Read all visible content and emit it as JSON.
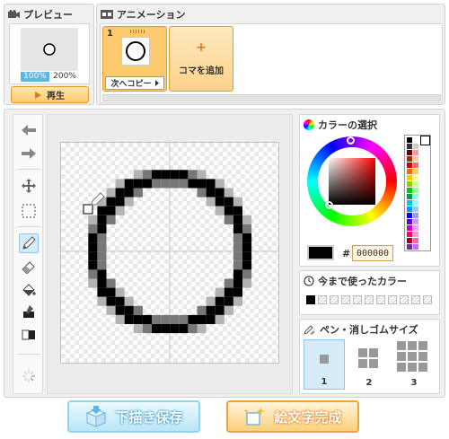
{
  "preview": {
    "title": "プレビュー",
    "zoom_100": "100%",
    "zoom_200": "200%",
    "play_label": "再生"
  },
  "animation": {
    "title": "アニメーション",
    "frame_number": "1",
    "next_copy_label": "次へコピー",
    "add_frame_label": "コマを追加"
  },
  "color_picker": {
    "title": "カラーの選択",
    "hash": "#",
    "hex_value": "000000",
    "current_color": "#000000"
  },
  "recent_colors": {
    "title": "今まで使ったカラー"
  },
  "pen_size": {
    "title": "ペン・消しゴムサイズ",
    "sizes": [
      "1",
      "2",
      "3"
    ]
  },
  "actions": {
    "save_draft_label": "下描き保存",
    "complete_label": "絵文字完成"
  },
  "tools": [
    "undo-icon",
    "redo-icon",
    "move-icon",
    "select-icon",
    "pencil-icon",
    "eraser-icon",
    "fill-icon",
    "eyedropper-icon",
    "copy-icon",
    "loading-icon"
  ],
  "colors": {
    "accent_orange": "#fdca6e",
    "accent_blue": "#8fd5f0",
    "selected_tool": "#d6ecf8"
  }
}
